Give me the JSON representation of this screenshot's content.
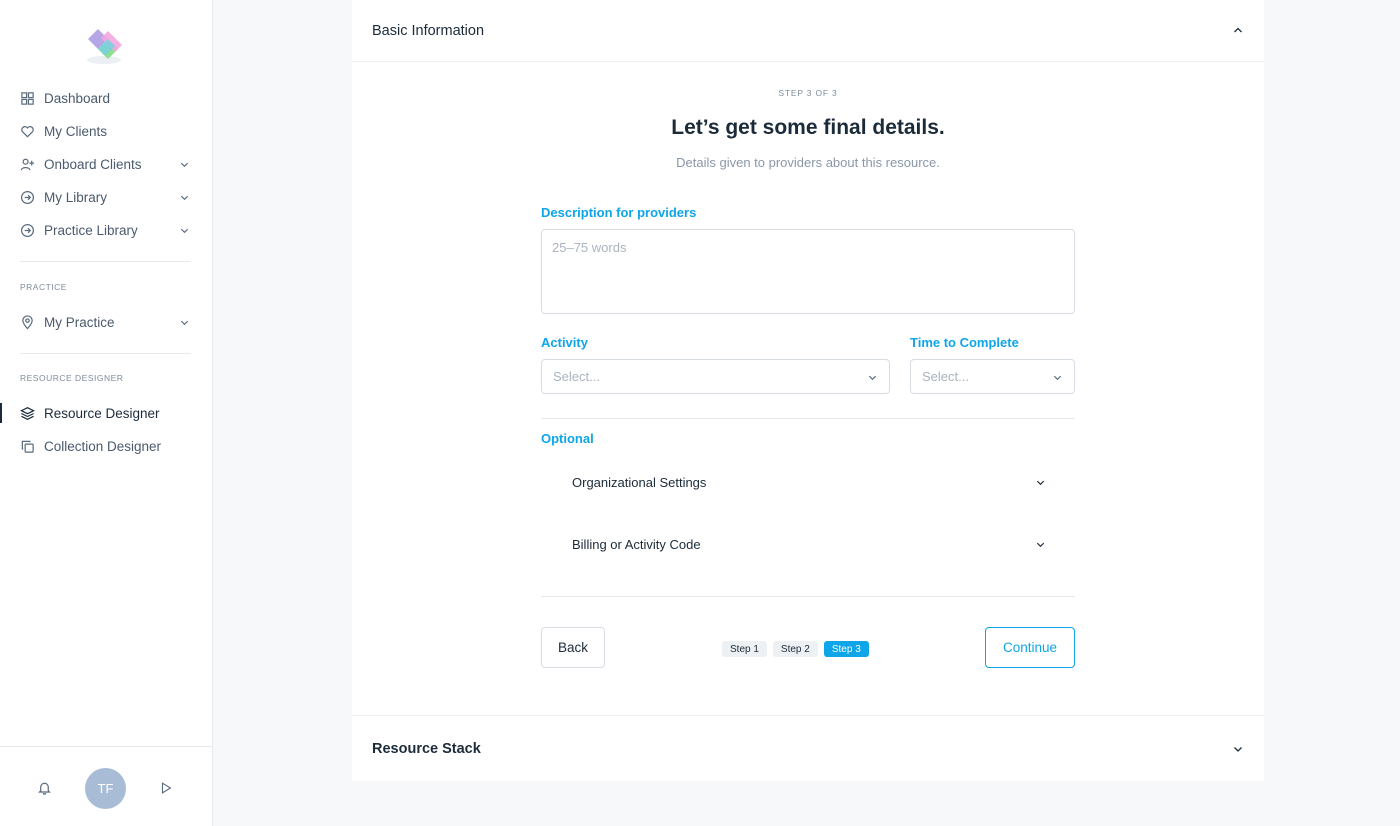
{
  "sidebar": {
    "items": [
      {
        "label": "Dashboard",
        "icon": "grid-icon",
        "has_chevron": false
      },
      {
        "label": "My Clients",
        "icon": "heart-icon",
        "has_chevron": false
      },
      {
        "label": "Onboard Clients",
        "icon": "user-plus-icon",
        "has_chevron": true
      },
      {
        "label": "My Library",
        "icon": "arrow-circle-icon",
        "has_chevron": true
      },
      {
        "label": "Practice Library",
        "icon": "arrow-circle-icon",
        "has_chevron": true
      }
    ],
    "practice_section_label": "PRACTICE",
    "practice_items": [
      {
        "label": "My Practice",
        "icon": "map-pin-icon",
        "has_chevron": true
      }
    ],
    "designer_section_label": "RESOURCE DESIGNER",
    "designer_items": [
      {
        "label": "Resource Designer",
        "icon": "layers-icon",
        "active": true
      },
      {
        "label": "Collection Designer",
        "icon": "copy-icon",
        "active": false
      }
    ],
    "footer": {
      "avatar_initials": "TF"
    }
  },
  "basic_info": {
    "title": "Basic Information",
    "step_kicker": "STEP 3 OF 3",
    "step_title": "Let’s get some final details.",
    "step_subtitle": "Details given to providers about this resource.",
    "description": {
      "label": "Description for providers",
      "placeholder": "25–75 words",
      "value": ""
    },
    "activity": {
      "label": "Activity",
      "placeholder": "Select..."
    },
    "time_to_complete": {
      "label": "Time to Complete",
      "placeholder": "Select..."
    },
    "optional": {
      "label": "Optional",
      "rows": [
        "Organizational Settings",
        "Billing or Activity Code"
      ]
    },
    "back_label": "Back",
    "continue_label": "Continue",
    "steps": [
      "Step 1",
      "Step 2",
      "Step 3"
    ],
    "current_step_index": 2
  },
  "resource_stack": {
    "title": "Resource Stack"
  },
  "colors": {
    "accent": "#0ea5e9",
    "text": "#1c2b3a",
    "muted": "#8a98a8",
    "background": "#f6f8fa"
  }
}
